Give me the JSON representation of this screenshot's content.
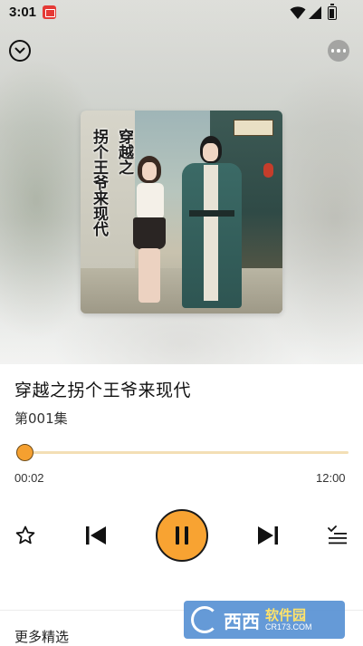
{
  "status_bar": {
    "time": "3:01"
  },
  "cover": {
    "title_line_1": "穿越之",
    "title_line_2": "拐个王爷来现代"
  },
  "book": {
    "title": "穿越之拐个王爷来现代",
    "episode": "第001集"
  },
  "player": {
    "current_time": "00:02",
    "total_time": "12:00",
    "progress_fraction": 0.003,
    "accent_color": "#f8a332",
    "state": "playing"
  },
  "controls": {
    "favorite_icon": "star-icon",
    "prev_icon": "skip-previous-icon",
    "play_icon": "pause-icon",
    "next_icon": "skip-next-icon",
    "list_icon": "playlist-icon"
  },
  "section": {
    "more_label": "更多精选"
  },
  "watermark": {
    "brand": "西西",
    "tagline": "软件园",
    "url": "CR173.COM"
  }
}
